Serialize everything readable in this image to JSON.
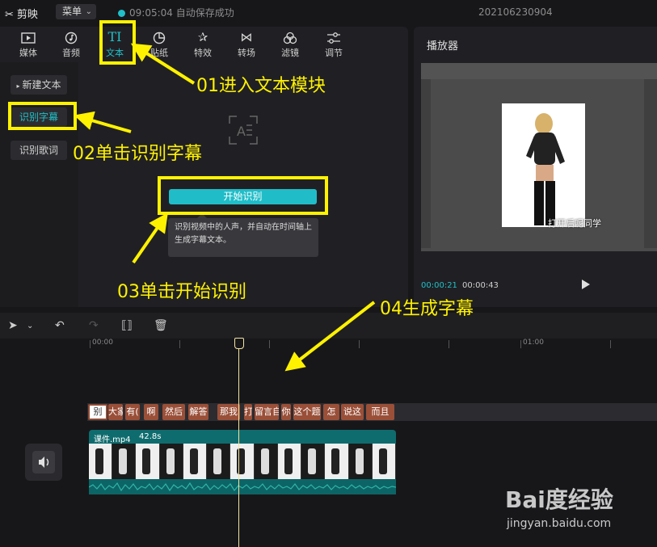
{
  "topbar": {
    "app_name": "剪映",
    "menu_label": "菜单",
    "save_status": "09:05:04 自动保存成功",
    "project_name": "202106230904"
  },
  "toolbar_tabs": [
    {
      "label": "媒体",
      "icon": "media-icon"
    },
    {
      "label": "音频",
      "icon": "audio-icon"
    },
    {
      "label": "文本",
      "icon": "text-icon",
      "glyph": "TI",
      "active": true
    },
    {
      "label": "贴纸",
      "icon": "sticker-icon"
    },
    {
      "label": "特效",
      "icon": "effects-icon"
    },
    {
      "label": "转场",
      "icon": "transition-icon"
    },
    {
      "label": "滤镜",
      "icon": "filter-icon"
    },
    {
      "label": "调节",
      "icon": "adjust-icon"
    }
  ],
  "sidebar": {
    "items": [
      {
        "label": "新建文本"
      },
      {
        "label": "识别字幕",
        "active": true
      },
      {
        "label": "识别歌词"
      }
    ]
  },
  "content": {
    "start_button": "开始识别",
    "tooltip": "识别视频中的人声，并自动在时间轴上生成字幕文本。"
  },
  "player": {
    "title": "播放器",
    "subtitle": "打开后呢同学",
    "time_current": "00:00:21",
    "time_total": "00:00:43"
  },
  "timeline": {
    "ruler_labels": [
      "00:00",
      "01:00"
    ],
    "captions": [
      "别",
      "大家",
      "有(",
      "啊",
      "然后",
      "解答",
      "那我",
      "打",
      "留言自",
      "你",
      "这个题",
      "怎",
      "说这",
      "而且"
    ],
    "clip_name": "课件.mp4",
    "clip_duration": "42.8s"
  },
  "annotations": {
    "step1": "01进入文本模块",
    "step2": "02单击识别字幕",
    "step3": "03单击开始识别",
    "step4": "04生成字幕",
    "color": "#fff200"
  },
  "watermark": {
    "logo": "Bai度经验",
    "url": "jingyan.baidu.com"
  },
  "colors": {
    "accent": "#21c0c8",
    "caption": "#9a4f38",
    "clip": "#0f6c6e"
  }
}
